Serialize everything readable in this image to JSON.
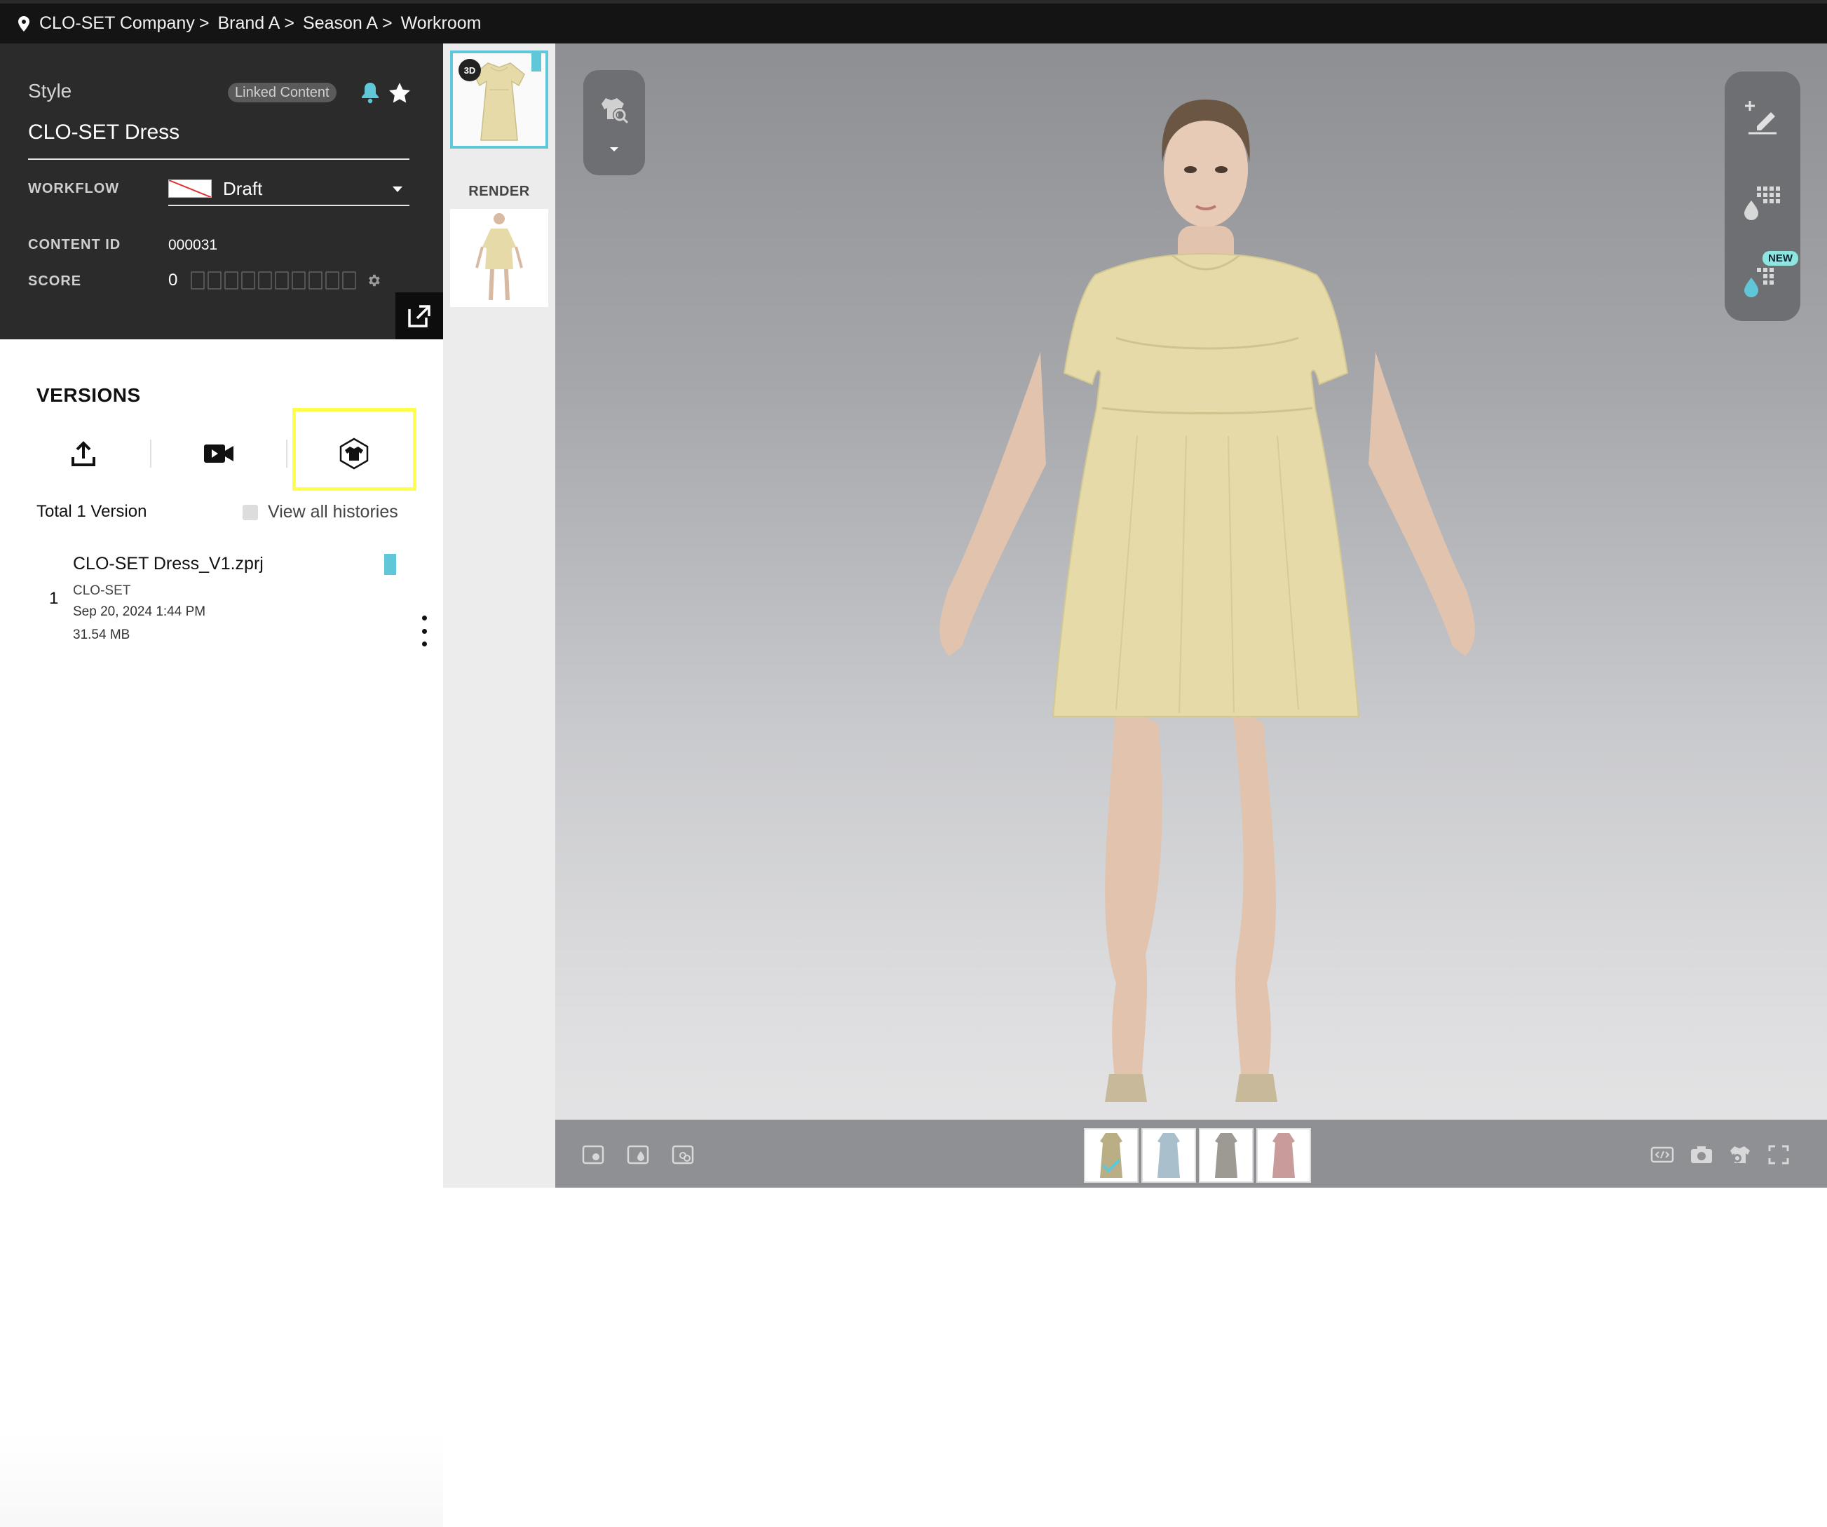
{
  "breadcrumb": {
    "items": [
      "CLO-SET Company",
      "Brand A",
      "Season A",
      "Workroom"
    ],
    "separator": ">"
  },
  "style_panel": {
    "section_label": "Style",
    "linked_badge": "Linked Content",
    "name": "CLO-SET Dress",
    "workflow_label": "WORKFLOW",
    "workflow_value": "Draft",
    "content_id_label": "CONTENT ID",
    "content_id_value": "000031",
    "score_label": "SCORE",
    "score_value": "0",
    "score_max_boxes": 10
  },
  "versions": {
    "title": "VERSIONS",
    "tools": [
      "upload-icon",
      "video-icon",
      "garment-3d-icon"
    ],
    "total_label": "Total 1 Version",
    "view_all_label": "View all histories",
    "view_all_checked": false,
    "items": [
      {
        "number": "1",
        "file": "CLO-SET Dress_V1.zprj",
        "author": "CLO-SET",
        "date": "Sep 20, 2024 1:44 PM",
        "size": "31.54 MB"
      }
    ]
  },
  "thumbnails": {
    "badge_3d": "3D",
    "render_label": "RENDER"
  },
  "viewer": {
    "new_badge": "NEW",
    "colorways": [
      "#b9ae84",
      "#a9bfcb",
      "#9c9a93",
      "#c79c9a"
    ],
    "accent": "#5fc7d8",
    "dress_color": "#e6dba8"
  }
}
